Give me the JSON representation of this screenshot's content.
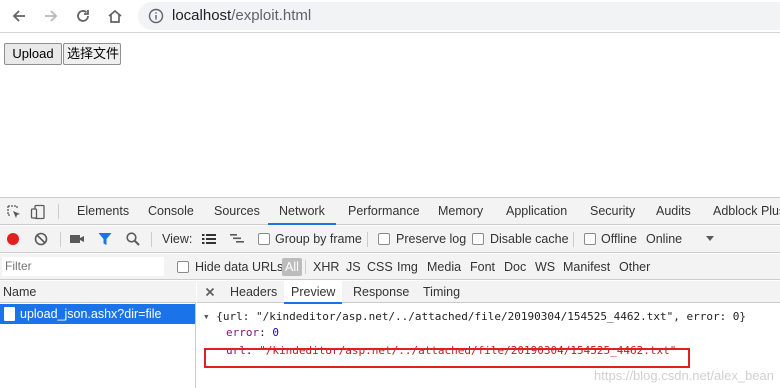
{
  "browser": {
    "url_host": "localhost",
    "url_path": "/exploit.html"
  },
  "page": {
    "upload_label": "Upload",
    "choose_file_label": "选择文件"
  },
  "devtools": {
    "tabs": [
      "Elements",
      "Console",
      "Sources",
      "Network",
      "Performance",
      "Memory",
      "Application",
      "Security",
      "Audits",
      "Adblock Plus"
    ],
    "active_tab": "Network",
    "toolbar": {
      "view_label": "View:",
      "group_by_frame": "Group by frame",
      "preserve_log": "Preserve log",
      "disable_cache": "Disable cache",
      "offline": "Offline",
      "throttle": "Online"
    },
    "filter": {
      "placeholder": "Filter",
      "hide_data_urls": "Hide data URLs",
      "types": [
        "All",
        "XHR",
        "JS",
        "CSS",
        "Img",
        "Media",
        "Font",
        "Doc",
        "WS",
        "Manifest",
        "Other"
      ]
    },
    "requests": {
      "header": "Name",
      "items": [
        "upload_json.ashx?dir=file"
      ]
    },
    "detail": {
      "tabs": [
        "Headers",
        "Preview",
        "Response",
        "Timing"
      ],
      "active_tab": "Preview",
      "summary": "{url: \"/kindeditor/asp.net/../attached/file/20190304/154525_4462.txt\", error: 0}",
      "error_key": "error",
      "error_value": "0",
      "url_key": "url",
      "url_value": "\"/kindeditor/asp.net/../attached/file/20190304/154525_4462.txt\""
    },
    "watermark": "https://blog.csdn.net/alex_bean"
  },
  "colors": {
    "accent": "#1a73e8",
    "highlight_box": "#e0201e",
    "record_dot": "#e0201e"
  }
}
